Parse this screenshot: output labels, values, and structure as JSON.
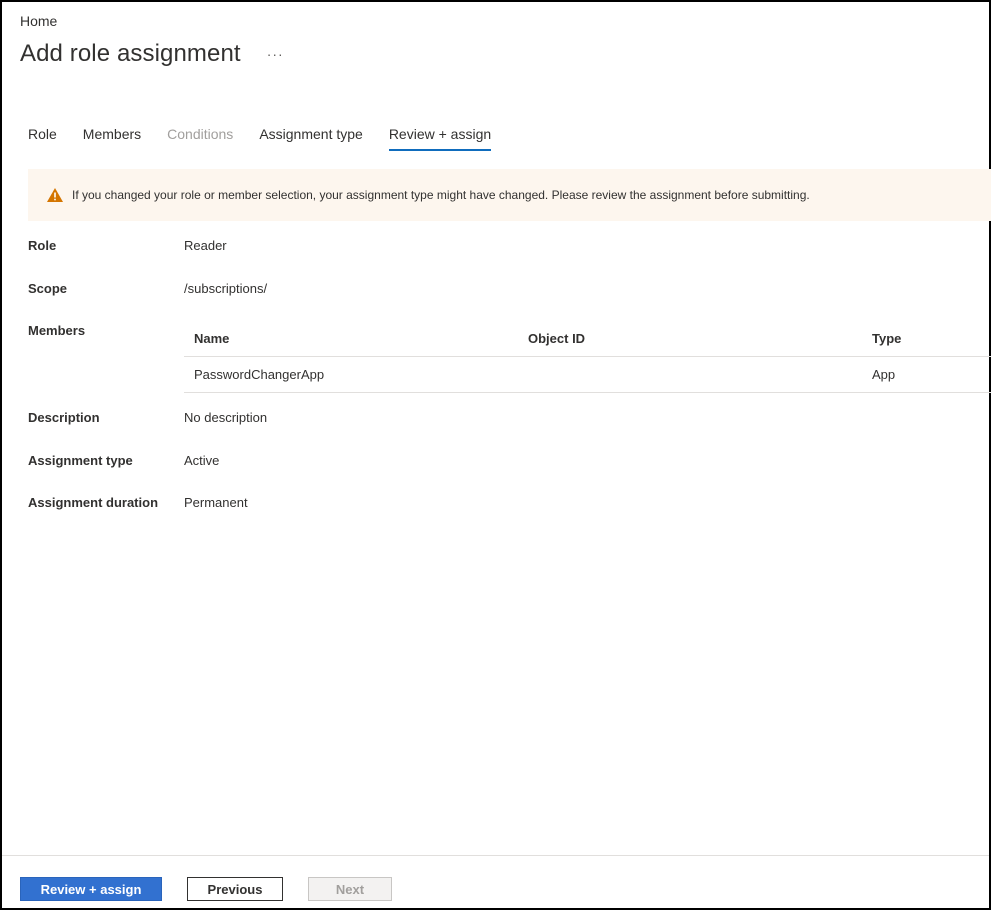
{
  "breadcrumb": "Home",
  "page_title": "Add role assignment",
  "more_label": "···",
  "tabs": [
    {
      "label": "Role",
      "state": "normal"
    },
    {
      "label": "Members",
      "state": "normal"
    },
    {
      "label": "Conditions",
      "state": "disabled"
    },
    {
      "label": "Assignment type",
      "state": "normal"
    },
    {
      "label": "Review + assign",
      "state": "active"
    }
  ],
  "warning": {
    "icon": "warning-triangle-icon",
    "text": "If you changed your role or member selection, your assignment type might have changed. Please review the assignment before submitting.",
    "color": "#d47500"
  },
  "details": {
    "role_label": "Role",
    "role_value": "Reader",
    "scope_label": "Scope",
    "scope_value": "/subscriptions/",
    "members_label": "Members",
    "description_label": "Description",
    "description_value": "No description",
    "assignment_type_label": "Assignment type",
    "assignment_type_value": "Active",
    "assignment_duration_label": "Assignment duration",
    "assignment_duration_value": "Permanent"
  },
  "members_table": {
    "headers": {
      "name": "Name",
      "object_id": "Object ID",
      "type": "Type"
    },
    "rows": [
      {
        "name": "PasswordChangerApp",
        "object_id": "",
        "type": "App"
      }
    ]
  },
  "footer": {
    "review_assign": "Review + assign",
    "previous": "Previous",
    "next": "Next"
  },
  "colors": {
    "accent": "#0f6cbd",
    "primary_button": "#3271d0",
    "warning_bg": "#fdf6ee"
  }
}
